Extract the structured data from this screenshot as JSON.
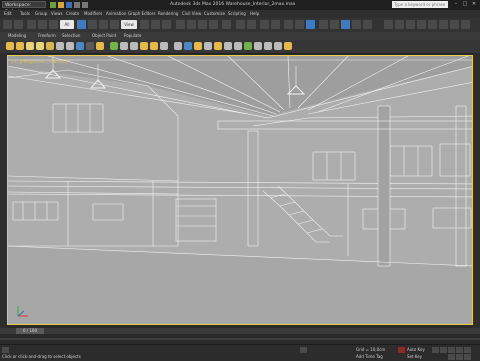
{
  "titlebar": {
    "workspace": "Workspace: Default",
    "title": "Autodesk 3ds Max 2016    Warehouse_Interior_2max.max",
    "search_placeholder": "Type a keyword or phrase",
    "minimize": "–",
    "maximize": "□",
    "close": "✕"
  },
  "menubar": {
    "items": [
      "Edit",
      "Tools",
      "Group",
      "Views",
      "Create",
      "Modifiers",
      "Animation",
      "Graph Editors",
      "Rendering",
      "Civil View",
      "Customize",
      "Scripting",
      "Help"
    ]
  },
  "toolbar": {
    "selection_filter": "All",
    "ref_coord": "View"
  },
  "ribbon": {
    "tabs": [
      "Modeling",
      "Freeform",
      "Selection",
      "Object Paint",
      "Populate"
    ]
  },
  "viewport": {
    "label": "[+] [Perspective] [Realistic]"
  },
  "timeline": {
    "frame_display": "0 / 100"
  },
  "status": {
    "prompt": "Click or click-and-drag to select objects",
    "grid": "Grid = 10,0cm",
    "add_time_tag": "Add Time Tag",
    "auto_key": "Auto Key",
    "set_key": "Set Key",
    "selected": "Selected"
  },
  "colors": {
    "accent": "#3d7bc4",
    "viewport_bg": "#adadad",
    "viewport_border": "#e8c84a"
  }
}
